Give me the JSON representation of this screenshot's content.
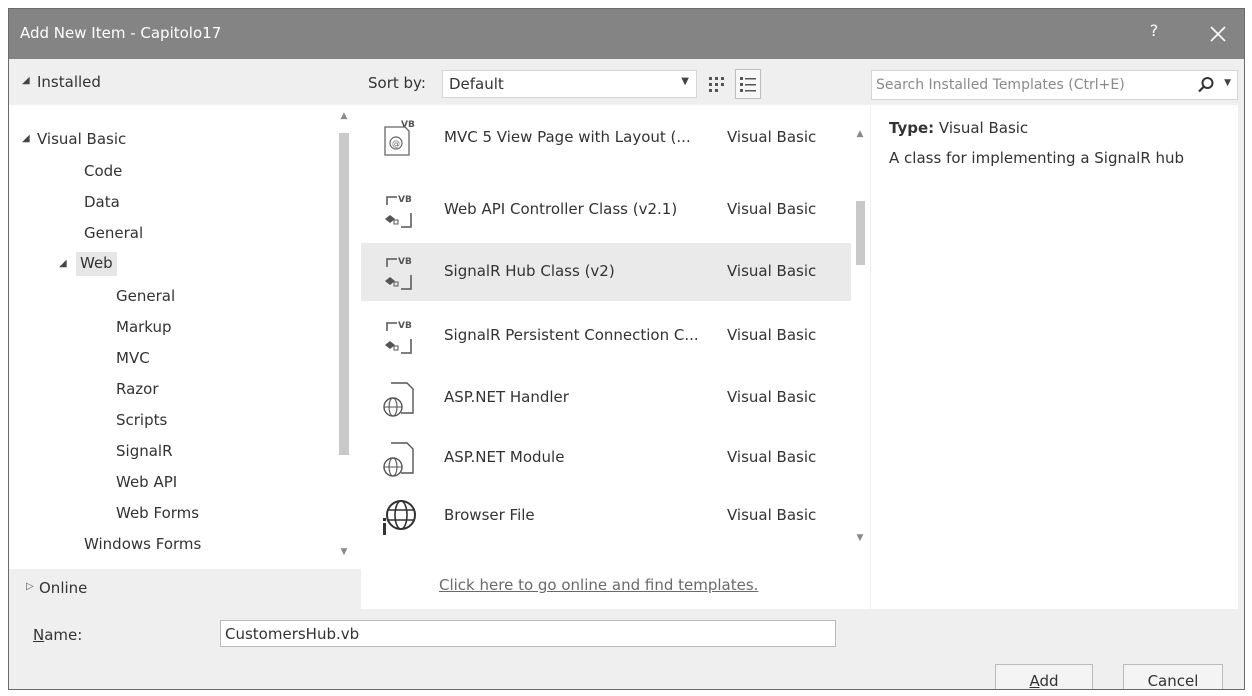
{
  "window": {
    "title": "Add New Item - Capitolo17",
    "help_label": "?"
  },
  "tree": {
    "installed_label": "Installed",
    "root": {
      "label": "Visual Basic",
      "expanded": true
    },
    "items": [
      {
        "label": "Code"
      },
      {
        "label": "Data"
      },
      {
        "label": "General"
      },
      {
        "label": "Web",
        "expanded": true,
        "selected": true
      },
      {
        "label": "General"
      },
      {
        "label": "Markup"
      },
      {
        "label": "MVC"
      },
      {
        "label": "Razor"
      },
      {
        "label": "Scripts"
      },
      {
        "label": "SignalR"
      },
      {
        "label": "Web API"
      },
      {
        "label": "Web Forms"
      },
      {
        "label": "Windows Forms"
      }
    ],
    "online_label": "Online"
  },
  "toolbar": {
    "sort_label": "Sort by:",
    "sort_value": "Default",
    "view_modes": [
      "small-icons-view",
      "list-view"
    ]
  },
  "templates": [
    {
      "name": "MVC 5 View Page with Layout (...",
      "language": "Visual Basic",
      "icon": "vb-view-page-icon",
      "badge": "VB"
    },
    {
      "name": "Web API Controller Class (v2.1)",
      "language": "Visual Basic",
      "icon": "vb-class-icon",
      "badge": "VB"
    },
    {
      "name": "SignalR Hub Class (v2)",
      "language": "Visual Basic",
      "icon": "vb-class-icon",
      "badge": "VB",
      "selected": true
    },
    {
      "name": "SignalR Persistent Connection C...",
      "language": "Visual Basic",
      "icon": "vb-class-icon",
      "badge": "VB"
    },
    {
      "name": "ASP.NET Handler",
      "language": "Visual Basic",
      "icon": "web-file-icon"
    },
    {
      "name": "ASP.NET Module",
      "language": "Visual Basic",
      "icon": "web-file-icon"
    },
    {
      "name": "Browser File",
      "language": "Visual Basic",
      "icon": "browser-file-icon"
    }
  ],
  "online_link": "Click here to go online and find templates.",
  "search": {
    "placeholder": "Search Installed Templates (Ctrl+E)",
    "value": ""
  },
  "details": {
    "type_label": "Type:",
    "type_value": "Visual Basic",
    "description": "A class for implementing a SignalR hub"
  },
  "form": {
    "name_label_accel": "N",
    "name_label_rest": "ame:",
    "name_value": "CustomersHub.vb",
    "add_accel": "A",
    "add_rest": "dd",
    "cancel_label": "Cancel"
  }
}
